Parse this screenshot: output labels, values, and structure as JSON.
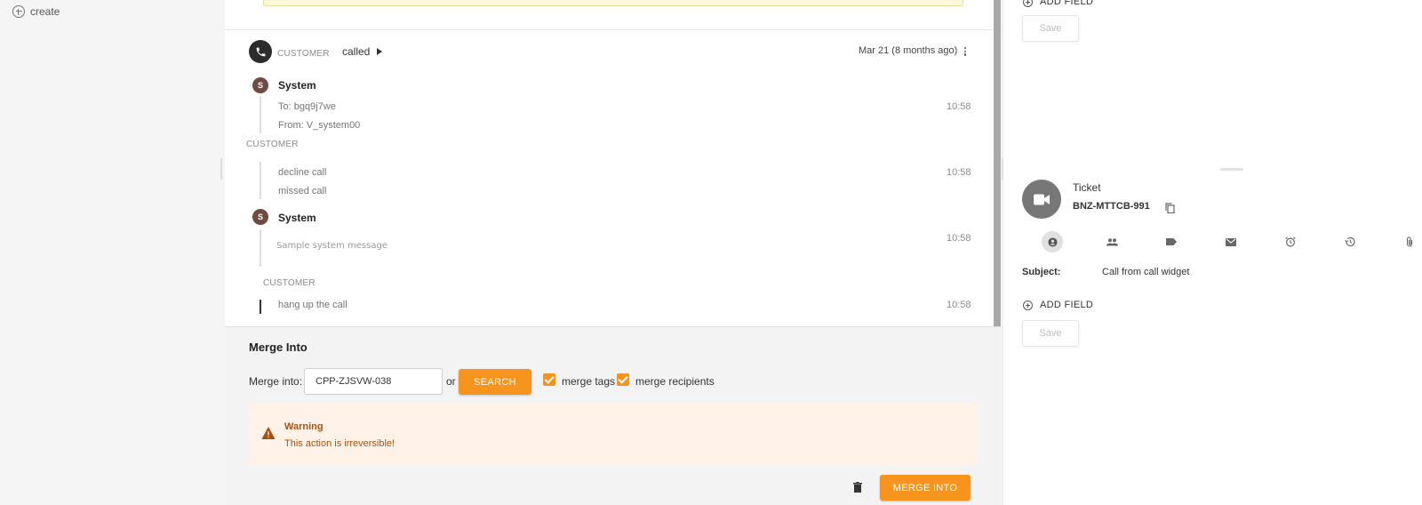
{
  "nav": {
    "create_label": "create"
  },
  "thread": {
    "customer_label": "CUSTOMER",
    "call_label": "called",
    "date": "Mar 21 (8 months ago)",
    "messages": [
      {
        "author": "System",
        "avatar": "S",
        "lines": [
          "To: bgq9j7we",
          "From: V_system00"
        ],
        "time": "10:58"
      },
      {
        "section": "CUSTOMER",
        "lines": [
          "decline call",
          "missed call"
        ],
        "time": "10:58"
      },
      {
        "author": "System",
        "avatar": "S",
        "lines": [
          "Sample system message"
        ],
        "time": "10:58"
      },
      {
        "section": "CUSTOMER",
        "lines": [
          "hang up the call"
        ],
        "time": "10:58"
      }
    ]
  },
  "merge": {
    "title": "Merge Into",
    "input_label": "Merge into:",
    "input_value": "CPP-ZJSVW-038",
    "or_label": "or",
    "search_label": "SEARCH",
    "merge_tags_label": "merge tags",
    "merge_recipients_label": "merge recipients",
    "warning_title": "Warning",
    "warning_text": "This action is irreversible!",
    "merge_button_label": "MERGE INTO"
  },
  "right_panel": {
    "add_field_label": "ADD FIELD",
    "save_label": "Save",
    "ticket_label": "Ticket",
    "ticket_id": "BNZ-MTTCB-991",
    "subject_label": "Subject:",
    "subject_value": "Call from call widget",
    "tabs": [
      "account-circle-icon",
      "people-icon",
      "tag-icon",
      "mail-icon",
      "alarm-icon",
      "history-icon",
      "attachment-icon"
    ]
  },
  "colors": {
    "accent": "#f7941d",
    "warning_bg": "#fff3e9",
    "warning_text": "#a65111"
  }
}
